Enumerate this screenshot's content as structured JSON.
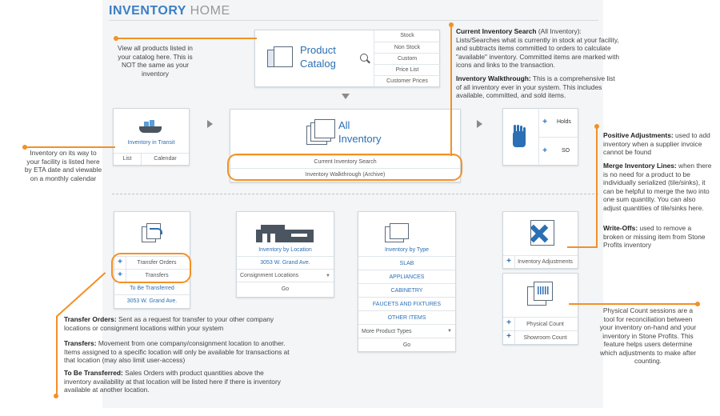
{
  "header": {
    "title_a": "INVENTORY",
    "title_b": "HOME"
  },
  "product_catalog": {
    "label_line1": "Product",
    "label_line2": "Catalog",
    "menu": [
      "Stock",
      "Non Stock",
      "Custom",
      "Price List",
      "Customer Prices"
    ]
  },
  "transit": {
    "label": "Inventory in Transit",
    "buttons": [
      "List",
      "Calendar"
    ]
  },
  "all_inventory": {
    "label_line1": "All",
    "label_line2": "Inventory",
    "links": [
      "Current Inventory Search",
      "Inventory Walkthrough (Archive)"
    ]
  },
  "holds": {
    "items": [
      "Holds",
      "SO"
    ]
  },
  "transfers": {
    "items": [
      "Transfer Orders",
      "Transfers"
    ],
    "to_be_label": "To Be Transferred",
    "address": "3053 W. Grand Ave."
  },
  "by_location": {
    "label": "Inventory by Location",
    "address": "3053 W. Grand Ave.",
    "select": "Consignment Locations",
    "go": "Go"
  },
  "by_type": {
    "label": "Inventory by Type",
    "types": [
      "SLAB",
      "APPLIANCES",
      "CABINETRY",
      "FAUCETS AND FIXTURES",
      "OTHER ITEMS"
    ],
    "select": "More Product Types",
    "go": "Go"
  },
  "adjustments": {
    "label": "Inventory Adjustments"
  },
  "physical": {
    "items": [
      "Physical Count",
      "Showroom Count"
    ]
  },
  "notes": {
    "catalog": "View all products listed in your catalog here. This is NOT the same as your inventory",
    "transit": "Inventory on its way to your facility is listed here by ETA date and viewable on a monthly calendar",
    "search_title": "Current Inventory Search",
    "search_suffix": " (All Inventory):",
    "search_body": "Lists/Searches what is currently in stock at your facility, and subtracts items committed to orders to calculate \"available\" inventory. Committed items are marked with icons and links to the transaction.",
    "walk_title": "Inventory Walkthrough:",
    "walk_body": " This is a comprehensive list of all inventory ever in your system. This includes available, committed, and sold items.",
    "pos_title": "Positive Adjustments:",
    "pos_body": " used to add inventory when a supplier invoice cannot be found",
    "merge_title": "Merge Inventory Lines:",
    "merge_body": " when there is no need for a product to be individually serialized (tile/sinks), it can be helpful to merge the two into one sum quantity. You can also adjust quantities of tile/sinks here.",
    "write_title": "Write-Offs:",
    "write_body": " used to remove a broken or missing item from Stone Profits inventory",
    "physical": "Physical Count sessions are a tool for reconciliation between your inventory on-hand and your inventory in Stone Profits. This feature helps users determine which adjustments to make after counting.",
    "to_title": "Transfer Orders:",
    "to_body": " Sent as a request for transfer to your other company locations or consignment locations within your system",
    "tr_title": "Transfers:",
    "tr_body": " Movement from one company/consignment location to another. Items assigned to a specific location will only be available for transactions at that location (may also limit user-access)",
    "tbt_title": "To Be Transferred:",
    "tbt_body": " Sales Orders with product quantities above the inventory availability at that location will be listed here if there is inventory available at another location."
  },
  "colors": {
    "accent": "#f29126",
    "link": "#2b6fb4"
  }
}
